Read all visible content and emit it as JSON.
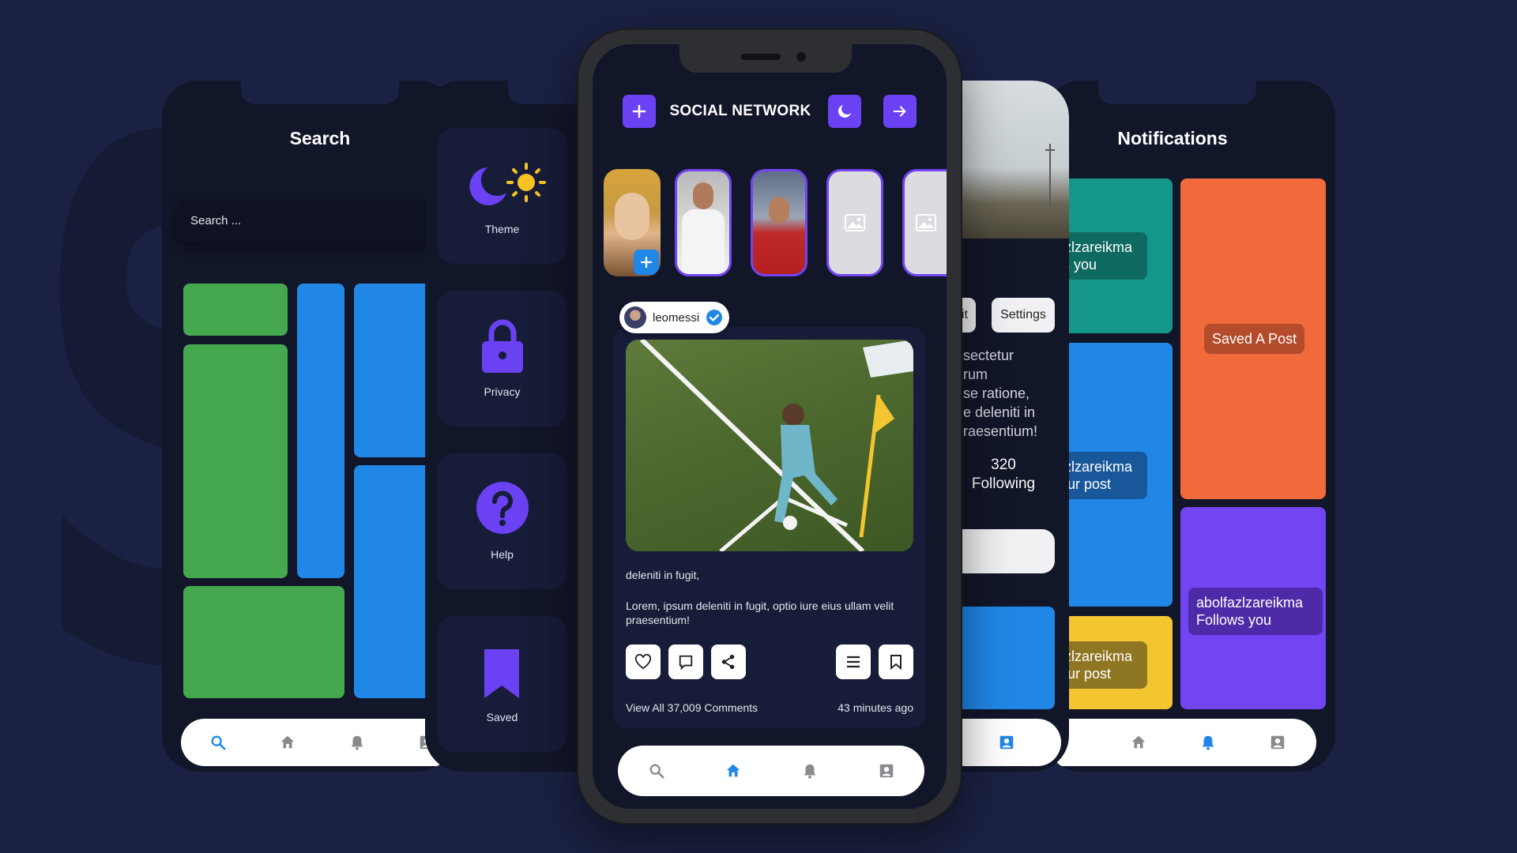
{
  "background_word": "SOCIAL NETWORK",
  "colors": {
    "bg": "#1b2142",
    "phone": "#121629",
    "accent": "#6a42f3",
    "green": "#46a84e",
    "blue": "#2087e6",
    "teal": "#15968a",
    "orange": "#f06a3b",
    "yellow": "#f3c631",
    "purple": "#7244f2"
  },
  "search_screen": {
    "title": "Search",
    "search_placeholder": "Search ..."
  },
  "settings_screen": {
    "items": [
      {
        "label": "Theme",
        "icon": "moon-sun-icon"
      },
      {
        "label": "Privacy",
        "icon": "lock-icon"
      },
      {
        "label": "Help",
        "icon": "help-icon"
      },
      {
        "label": "Saved",
        "icon": "bookmark-icon"
      }
    ]
  },
  "home_screen": {
    "app_title": "SOCIAL NETWORK",
    "post": {
      "username": "leomessi",
      "caption_title": "deleniti in fugit,",
      "caption_body": "Lorem, ipsum deleniti in fugit, optio iure eius ullam velit praesentium!",
      "comments": "View All 37,009 Comments",
      "time": "43 minutes ago"
    }
  },
  "profile_screen": {
    "edit_label": "lit",
    "settings_label": "Settings",
    "bio_lines": [
      "sectetur",
      "rum",
      "se ratione,",
      "e deleniti in",
      "raesentium!"
    ],
    "following_count": "320",
    "following_label": "Following"
  },
  "notifications_screen": {
    "title": "Notifications",
    "items": [
      {
        "line1": "fazlzareikma",
        "line2": "ws you"
      },
      {
        "line1": "Saved A Post",
        "line2": ""
      },
      {
        "line1": "fazlzareikma",
        "line2": "your post"
      },
      {
        "line1": "abolfazlzareikma",
        "line2": "Follows you"
      },
      {
        "line1": "fazlzareikma",
        "line2": "your post"
      }
    ]
  }
}
